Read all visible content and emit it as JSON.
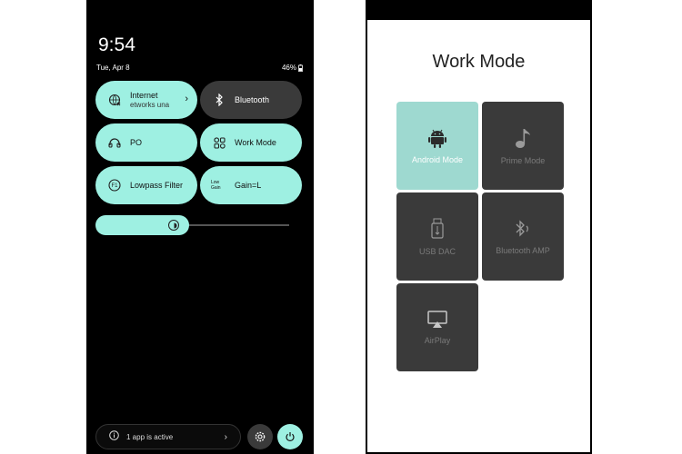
{
  "status": {
    "time": "9:54",
    "date": "Tue, Apr 8",
    "battery": "46%"
  },
  "tiles": [
    {
      "label": "Internet",
      "sub": "etworks una",
      "icon": "wifi-off-icon",
      "state": "on"
    },
    {
      "label": "Bluetooth",
      "icon": "bluetooth-icon",
      "state": "off"
    },
    {
      "label": "PO",
      "icon": "headphones-icon",
      "state": "on"
    },
    {
      "label": "Work Mode",
      "icon": "grid-icon",
      "state": "on"
    },
    {
      "label": "Lowpass Filter",
      "icon": "filter-f1-icon",
      "icon_text": "F1",
      "state": "on"
    },
    {
      "label": "Gain=L",
      "small": [
        "Low",
        "Gain"
      ],
      "state": "on"
    }
  ],
  "brightness": {
    "level": 0.45
  },
  "footer": {
    "active_text": "1 app is active"
  },
  "work_mode": {
    "title": "Work Mode",
    "modes": [
      {
        "label": "Android Mode",
        "icon": "android-icon",
        "selected": true
      },
      {
        "label": "Prime Mode",
        "icon": "music-note-icon",
        "selected": false
      },
      {
        "label": "USB DAC",
        "icon": "usb-icon",
        "selected": false
      },
      {
        "label": "Bluetooth AMP",
        "icon": "bluetooth-audio-icon",
        "selected": false
      },
      {
        "label": "AirPlay",
        "icon": "airplay-icon",
        "selected": false
      }
    ]
  },
  "colors": {
    "accent": "#9ef0e2",
    "tile_off": "#3a3a3a",
    "mode_selected": "#9ed9d0"
  }
}
